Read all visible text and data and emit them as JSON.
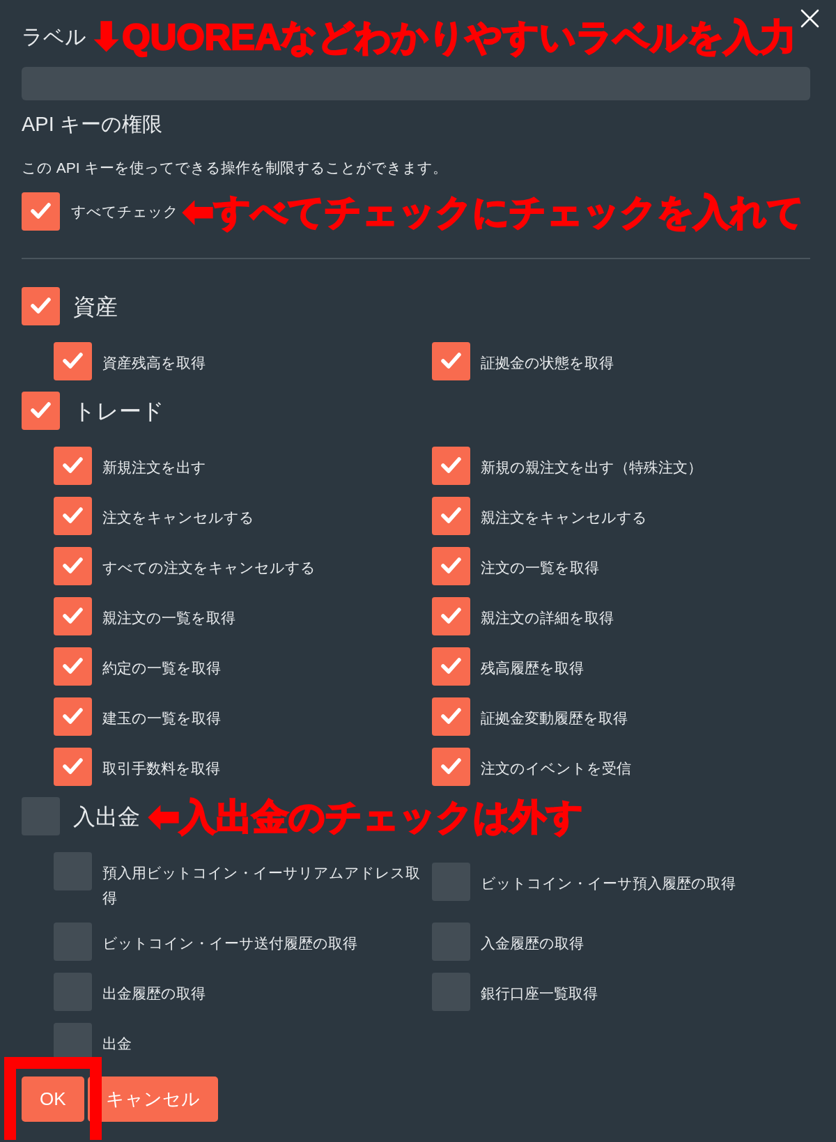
{
  "label_field": {
    "label": "ラベル",
    "annotation": {
      "arrow": "⬇",
      "text": "QUOREAなどわかりやすいラベルを入力"
    }
  },
  "permissions": {
    "title": "API キーの権限",
    "description": "この API キーを使ってできる操作を制限することができます。",
    "select_all": {
      "label": "すべてチェック",
      "checked": true,
      "annotation": {
        "arrow": "⬅",
        "text": "すべてチェックにチェックを入れて"
      }
    },
    "groups": [
      {
        "label": "資産",
        "checked": true,
        "items": [
          {
            "label": "資産残高を取得",
            "checked": true
          },
          {
            "label": "証拠金の状態を取得",
            "checked": true
          }
        ]
      },
      {
        "label": "トレード",
        "checked": true,
        "items": [
          {
            "label": "新規注文を出す",
            "checked": true
          },
          {
            "label": "新規の親注文を出す（特殊注文）",
            "checked": true
          },
          {
            "label": "注文をキャンセルする",
            "checked": true
          },
          {
            "label": "親注文をキャンセルする",
            "checked": true
          },
          {
            "label": "すべての注文をキャンセルする",
            "checked": true
          },
          {
            "label": "注文の一覧を取得",
            "checked": true
          },
          {
            "label": "親注文の一覧を取得",
            "checked": true
          },
          {
            "label": "親注文の詳細を取得",
            "checked": true
          },
          {
            "label": "約定の一覧を取得",
            "checked": true
          },
          {
            "label": "残高履歴を取得",
            "checked": true
          },
          {
            "label": "建玉の一覧を取得",
            "checked": true
          },
          {
            "label": "証拠金変動履歴を取得",
            "checked": true
          },
          {
            "label": "取引手数料を取得",
            "checked": true
          },
          {
            "label": "注文のイベントを受信",
            "checked": true
          }
        ]
      },
      {
        "label": "入出金",
        "checked": false,
        "annotation": {
          "arrow": "⬅",
          "text": "入出金のチェックは外す"
        },
        "items": [
          {
            "label": "預入用ビットコイン・イーサリアムアドレス取得",
            "checked": false
          },
          {
            "label": "ビットコイン・イーサ預入履歴の取得",
            "checked": false
          },
          {
            "label": "ビットコイン・イーサ送付履歴の取得",
            "checked": false
          },
          {
            "label": "入金履歴の取得",
            "checked": false
          },
          {
            "label": "出金履歴の取得",
            "checked": false
          },
          {
            "label": "銀行口座一覧取得",
            "checked": false
          },
          {
            "label": "出金",
            "checked": false
          }
        ]
      }
    ]
  },
  "buttons": [
    {
      "label": "OK",
      "highlighted": true
    },
    {
      "label": "キャンセル",
      "highlighted": false
    }
  ]
}
